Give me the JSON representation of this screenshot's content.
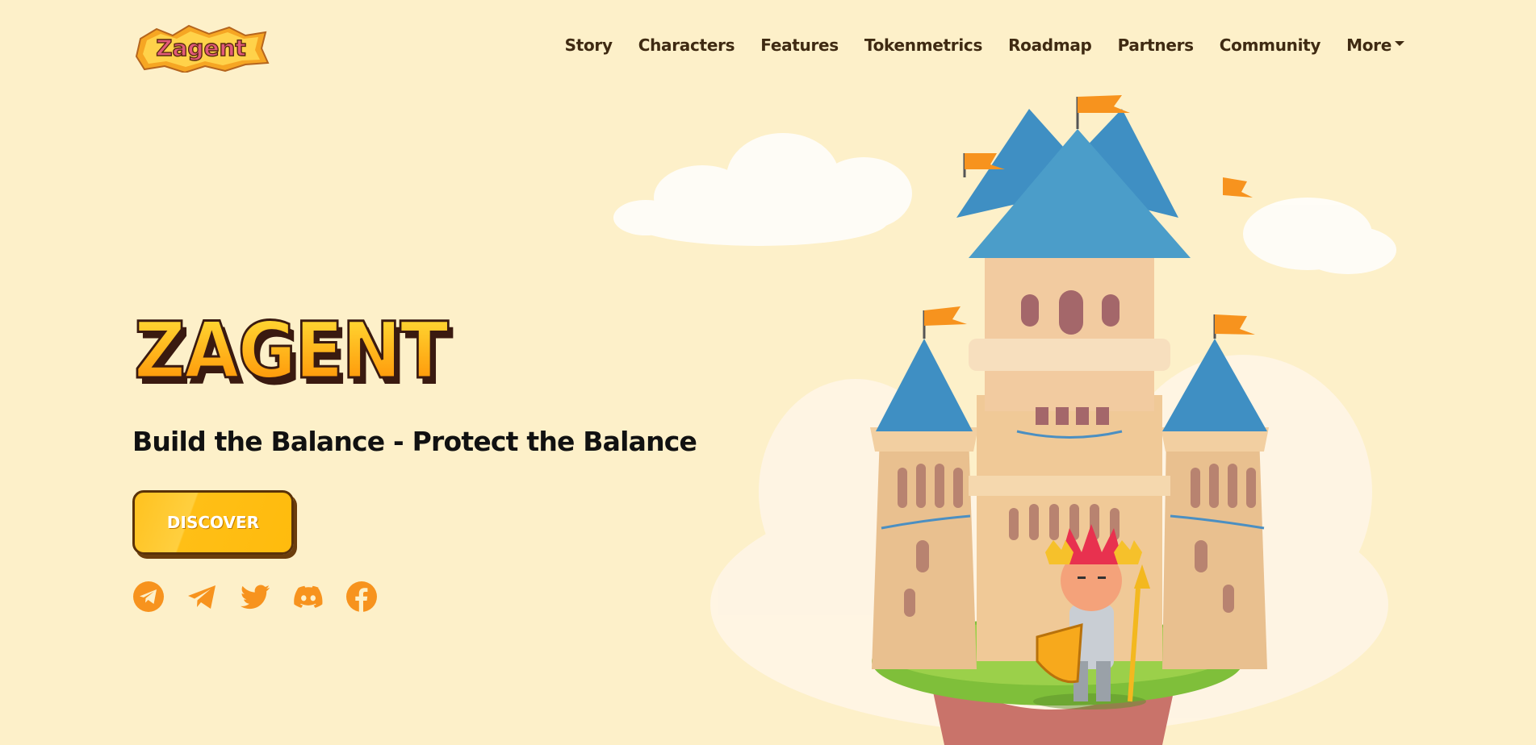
{
  "logo": {
    "text": "Zagent"
  },
  "nav": {
    "items": [
      "Story",
      "Characters",
      "Features",
      "Tokenmetrics",
      "Roadmap",
      "Partners",
      "Community"
    ],
    "more_label": "More"
  },
  "hero": {
    "title": "ZAGENT",
    "tagline": "Build the Balance - Protect the Balance",
    "cta_label": "DISCOVER"
  },
  "socials": [
    {
      "icon": "telegram-circle-icon"
    },
    {
      "icon": "telegram-plane-icon"
    },
    {
      "icon": "twitter-icon"
    },
    {
      "icon": "discord-icon"
    },
    {
      "icon": "facebook-icon"
    }
  ],
  "colors": {
    "background": "#fdf0c9",
    "accent": "#f7931e",
    "button": "#ffbf16",
    "nav_text": "#3f2a12"
  }
}
